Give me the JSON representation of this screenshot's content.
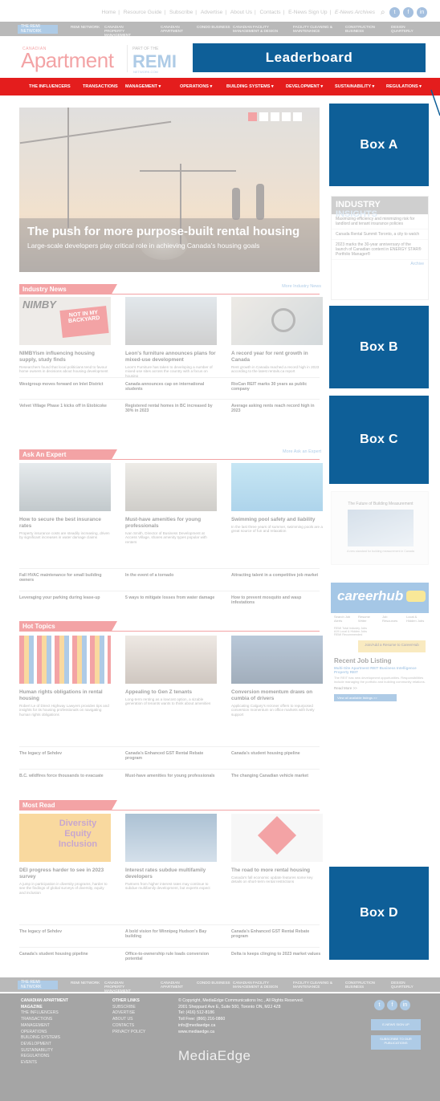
{
  "header": {
    "top_links": [
      "Home",
      "Resource Guide",
      "Subscribe",
      "Advertise",
      "About Us",
      "Contacts",
      "E-News Sign Up",
      "E-News Archives"
    ],
    "network_logo": "THE REMI NETWORK",
    "network_items": [
      "REMI NETWORK",
      "CANADIAN PROPERTY MANAGEMENT",
      "CANADIAN APARTMENT",
      "CONDO BUSINESS",
      "CANADIAN FACILITY MANAGEMENT & DESIGN",
      "FACILITY CLEANING & MAINTENANCE",
      "CONSTRUCTION BUSINESS",
      "DESIGN QUARTERLY"
    ],
    "brand": {
      "canadian": "CANADIAN",
      "apartment": "Apartment",
      "part_of": "PART OF THE",
      "remi": "REMI",
      "remi_sub": "NETWORK.COM"
    },
    "leaderboard": "Leaderboard",
    "nav": [
      "THE INFLUENCERS",
      "TRANSACTIONS",
      "MANAGEMENT ▾",
      "OPERATIONS ▾",
      "BUILDING SYSTEMS ▾",
      "DEVELOPMENT ▾",
      "SUSTAINABILITY ▾",
      "REGULATIONS ▾"
    ]
  },
  "hero": {
    "title": "The push for more purpose-built rental housing",
    "subtitle": "Large-scale developers play critical role in achieving Canada's housing goals"
  },
  "ads": {
    "box_a": "Box A",
    "box_b": "Box B",
    "box_c": "Box C",
    "box_d": "Box D"
  },
  "industry_news": {
    "heading": "Industry News",
    "more": "More Industry News",
    "cards": [
      {
        "title": "NIMBYism influencing housing supply, study finds",
        "desc": "Researchers found that local politicians tend to favour home owners in decisions about housing development"
      },
      {
        "title": "Leon's furniture announces plans for mixed-use development",
        "desc": "Leon's Furniture has taken to developing a number of mixed-use sites across the country with a focus on housing"
      },
      {
        "title": "A record year for rent growth in Canada",
        "desc": "Rent growth in Canada reached a record high in 2023 according to the latest rentals.ca report"
      }
    ],
    "links": [
      [
        "Westgroup moves forward on Inlet District",
        "Canada announces cap on international students",
        "RioCan REIT marks 30 years as public company"
      ],
      [
        "Velvet Village Phase 1 kicks off in Etobicoke",
        "Registered rental homes in BC increased by 30% in 2023",
        "Average asking rents reach record high in 2023"
      ]
    ]
  },
  "ask_an_expert": {
    "heading": "Ask An Expert",
    "more": "More Ask an Expert",
    "cards": [
      {
        "title": "How to secure the best insurance rates",
        "desc": "Property insurance costs are steadily increasing, driven by significant increases in water damage claims"
      },
      {
        "title": "Must-have amenities for young professionals",
        "desc": "Ivan Smith, Director of Business Development at Access Village, shares amenity types popular with renters"
      },
      {
        "title": "Swimming pool safety and liability",
        "desc": "In the last three years of summer, swimming pools are a great source of fun and relaxation"
      }
    ],
    "links": [
      [
        "Fall HVAC maintenance for small building owners",
        "In the event of a tornado",
        "Attracting talent in a competitive job market"
      ],
      [
        "Leveraging your parking during lease-up",
        "5 ways to mitigate losses from water damage",
        "How to prevent mosquito and wasp infestations"
      ]
    ]
  },
  "hot_topics": {
    "heading": "Hot Topics",
    "cards": [
      {
        "title": "Human rights obligations in rental housing",
        "desc": "Robert Le of Direct Highway Lawyers provides tips and insights for its housing professionals on navigating human rights obligations"
      },
      {
        "title": "Appealing to Gen Z tenants",
        "desc": "Long-term renting as a lowcost option, a sizable generation of tenants wants to think about amenities"
      },
      {
        "title": "Conversion momentum draws on cumbia of drivers",
        "desc": "Applicating Calgary's rezoner offers to repurposed conversion momentum on office markets with lively support"
      }
    ],
    "links": [
      [
        "The legacy of Sehdev",
        "Canada's Enhanced GST Rental Rebate program",
        "Canada's student housing pipeline"
      ],
      [
        "B.C. wildfires force thousands to evacuate",
        "Must-have amenities for young professionals",
        "The changing Canadian vehicle market"
      ]
    ]
  },
  "most_read": {
    "heading": "Most Read",
    "diversity_text": [
      "Diversity",
      "Equity",
      "Inclusion"
    ],
    "cards": [
      {
        "title": "DEI progress harder to see in 2023 survey",
        "desc": "A jump in participation in diversity programs, harder to see the findings of global surveys of diversity, equity and inclusion"
      },
      {
        "title": "Interest rates subdue multifamily developers",
        "desc": "Partners from higher interest rates may continue to subdue multifamily development, but experts expect"
      },
      {
        "title": "The road to more rental housing",
        "desc": "Canada's fall economic update features some key details on short-term rental restrictions"
      }
    ],
    "links": [
      [
        "The legacy of Sehdev",
        "A bold vision for Winnipeg Hudson's Bay building",
        "Canada's Enhanced GST Rental Rebate program"
      ],
      [
        "Canada's student housing pipeline",
        "Office-to-ownership rule loads conversion potential",
        "Delta is keeps clinging to 2023 market values"
      ]
    ]
  },
  "insights": {
    "title_a": "INDUSTRY",
    "title_b": "INSIGHTS",
    "items": [
      "Maximizing efficiency and minimizing risk for landlord and tenant insurance policies",
      "Canada Rental Summit Toronto, a city to watch",
      "2023 marks the 30-year anniversary of the launch of Canadian content in ENERGY STAR® Portfolio Manager®"
    ],
    "archive": "Archive"
  },
  "flyer": {
    "title": "The Future of Building Measurement",
    "byline": "A new standard for building measurement in Canada"
  },
  "careerhub": {
    "logo": "careerhub",
    "tabs": [
      "Search Job Alerts",
      "Resume Writer",
      "Job Resources",
      "Local & Hidden Jobs"
    ],
    "line1": "REMI Total Industry Jobs",
    "line2": "#19 Local & Hidden Jobs",
    "line3": "REMI Recommended",
    "post_button": "Join/Add a Resume to CareerHub",
    "recent": "Recent Job Listing",
    "job_title": "Multi-Site Apartment REIT Business Intelligence Property REIT",
    "job_desc": "The REIT has new development opportunities. Responsibilities include managing the portfolio and building community relations.",
    "read_more": "Read More >>",
    "view_all": "View all available listings >>"
  },
  "footer": {
    "col1": [
      "CANADIAN APARTMENT MAGAZINE",
      "THE INFLUENCERS",
      "TRANSACTIONS",
      "MANAGEMENT",
      "OPERATIONS",
      "BUILDING SYSTEMS",
      "DEVELOPMENT",
      "SUSTAINABILITY",
      "REGULATIONS",
      "EVENTS"
    ],
    "col2": [
      "OTHER LINKS",
      "SUBSCRIBE",
      "ADVERTISE",
      "ABOUT US",
      "CONTACTS",
      "PRIVACY POLICY"
    ],
    "copyright": [
      "© Copyright, MediaEdge Communications Inc., All Rights Reserved.",
      "2001 Sheppard Ave E, Suite 500, Toronto ON, M2J 4Z8",
      "Tel: (416) 512-8186",
      "Toll Free: (866) 216-0860",
      "info@mediaedge.ca",
      "www.mediaedge.ca"
    ],
    "mediaedge": "MediaEdge",
    "btn_enews": "E-NEWS SIGN UP",
    "btn_subscribe": "SUBSCRIBE TO OUR PUBLICATIONS"
  }
}
